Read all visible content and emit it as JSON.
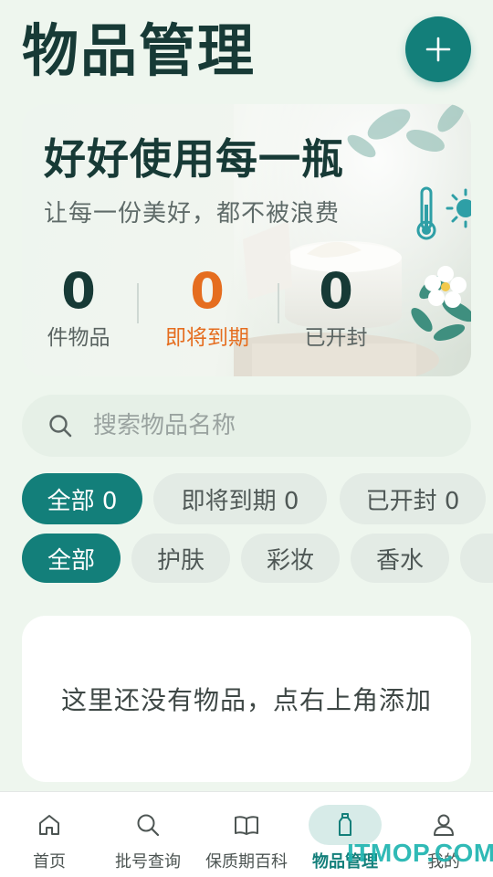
{
  "header": {
    "title": "物品管理"
  },
  "hero": {
    "title": "好好使用每一瓶",
    "subtitle": "让每一份美好，都不被浪费",
    "stats": [
      {
        "value": "0",
        "label": "件物品"
      },
      {
        "value": "0",
        "label": "即将到期"
      },
      {
        "value": "0",
        "label": "已开封"
      }
    ],
    "accent_colors": {
      "expiring": "#e56d1f",
      "primary": "#137f7a"
    }
  },
  "search": {
    "placeholder": "搜索物品名称",
    "value": ""
  },
  "status_filters": [
    {
      "label": "全部 0",
      "active": true
    },
    {
      "label": "即将到期 0",
      "active": false
    },
    {
      "label": "已开封 0",
      "active": false
    }
  ],
  "category_filters": [
    {
      "label": "全部",
      "active": true
    },
    {
      "label": "护肤",
      "active": false
    },
    {
      "label": "彩妆",
      "active": false
    },
    {
      "label": "香水",
      "active": false
    }
  ],
  "empty_state": {
    "message": "这里还没有物品，点右上角添加"
  },
  "bottom_nav": [
    {
      "label": "首页",
      "icon": "home-icon",
      "active": false
    },
    {
      "label": "批号查询",
      "icon": "search-icon",
      "active": false
    },
    {
      "label": "保质期百科",
      "icon": "book-icon",
      "active": false
    },
    {
      "label": "物品管理",
      "icon": "bottle-icon",
      "active": true
    },
    {
      "label": "我的",
      "icon": "person-icon",
      "active": false
    }
  ],
  "watermark": "ITMOP.COM"
}
